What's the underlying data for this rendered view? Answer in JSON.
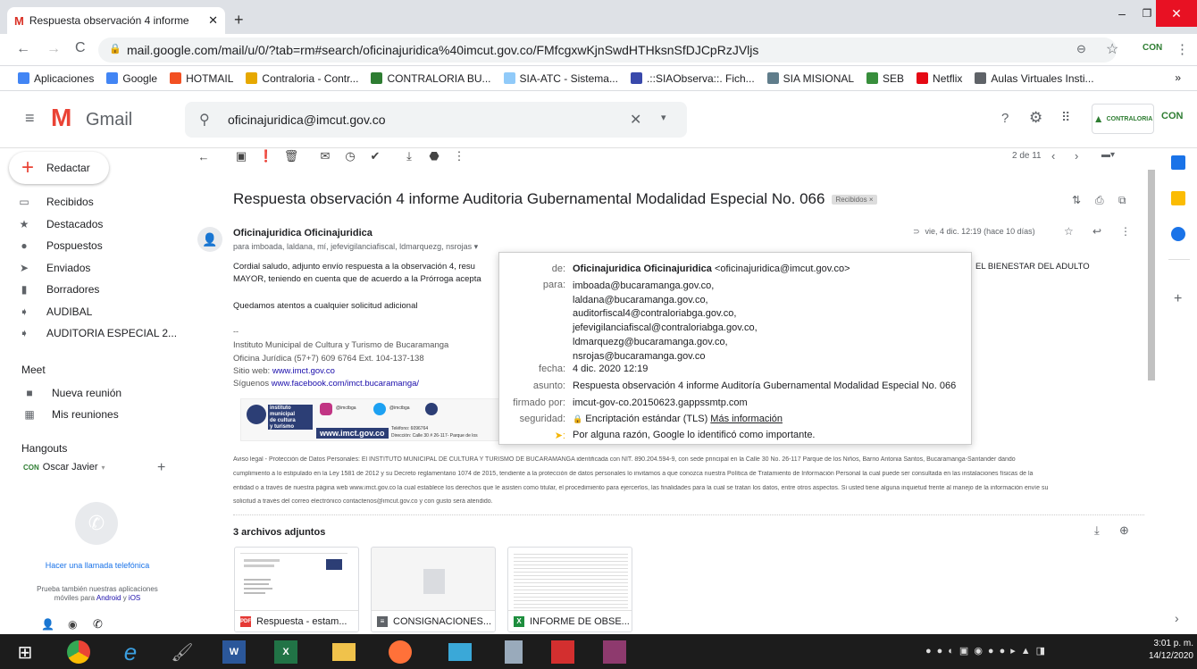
{
  "browser": {
    "tab_title": "Respuesta observación 4 informe",
    "url": "mail.google.com/mail/u/0/?tab=rm#search/oficinajuridica%40imcut.gov.co/FMfcgxwKjnSwdHTHksnSfDJCpRzJVljs",
    "bookmarks": [
      {
        "label": "Aplicaciones",
        "icon": "apps-grid-icon",
        "color": "#4285f4"
      },
      {
        "label": "Google",
        "icon": "google-g-icon",
        "color": "#4285f4"
      },
      {
        "label": "HOTMAIL",
        "icon": "windows-logo-icon",
        "color": "#f25022"
      },
      {
        "label": "Contraloria - Contr...",
        "icon": "contraloria-icon",
        "color": "#e6a800"
      },
      {
        "label": "CONTRALORIA BU...",
        "icon": "contraloria-bu-icon",
        "color": "#2e7d32"
      },
      {
        "label": "SIA-ATC - Sistema...",
        "icon": "sia-atc-icon",
        "color": "#90caf9"
      },
      {
        "label": ".::SIAObserva::. Fich...",
        "icon": "sia-observa-icon",
        "color": "#3949ab"
      },
      {
        "label": "SIA MISIONAL",
        "icon": "sia-misional-icon",
        "color": "#607d8b"
      },
      {
        "label": "SEB",
        "icon": "seb-icon",
        "color": "#388e3c"
      },
      {
        "label": "Netflix",
        "icon": "netflix-icon",
        "color": "#e50914"
      },
      {
        "label": "Aulas Virtuales Insti...",
        "icon": "aulas-icon",
        "color": "#5f6368"
      }
    ]
  },
  "gmail": {
    "brand": "Gmail",
    "search_value": "oficinajuridica@imcut.gov.co",
    "compose": "Redactar",
    "nav": [
      {
        "label": "Recibidos",
        "icon": "inbox-icon"
      },
      {
        "label": "Destacados",
        "icon": "star-icon"
      },
      {
        "label": "Pospuestos",
        "icon": "clock-icon"
      },
      {
        "label": "Enviados",
        "icon": "send-icon"
      },
      {
        "label": "Borradores",
        "icon": "draft-icon"
      },
      {
        "label": "AUDIBAL",
        "icon": "label-icon"
      },
      {
        "label": "AUDITORIA ESPECIAL 2...",
        "icon": "label-icon"
      }
    ],
    "meet": {
      "title": "Meet",
      "items": [
        {
          "label": "Nueva reunión",
          "icon": "video-icon"
        },
        {
          "label": "Mis reuniones",
          "icon": "calendar-icon"
        }
      ]
    },
    "hangouts": {
      "title": "Hangouts",
      "user": "Oscar Javier",
      "phone_link": "Hacer una llamada telefónica",
      "promo": "Prueba también nuestras aplicaciones",
      "promo2_pre": "móviles para",
      "android": "Android",
      "promo2_mid": "y",
      "ios": "iOS"
    },
    "pager": "2 de 11",
    "header_logo": "CONTRALORIA"
  },
  "email": {
    "subject": "Respuesta observación 4 informe Auditoria Gubernamental Modalidad Especial No. 066",
    "label": "Recibidos",
    "sender": "Oficinajuridica Oficinajuridica",
    "recipients": "para imboada, laldana, mí, jefevigilanciafiscal, ldmarquezg, nsrojas",
    "date": "vie, 4 dic. 12:19 (hace 10 días)",
    "body1": "Cordial saludo, adjunto envío respuesta a la observación 4,   resu",
    "body1_right": "EL BIENESTAR DEL ADULTO",
    "body2": "MAYOR, teniendo en cuenta que de acuerdo a la Prórroga acepta",
    "body3": "Quedamos atentos a cualquier solicitud adicional",
    "sig_dashes": "--",
    "sig1": "Instituto Municipal de Cultura y Turismo de Bucaramanga",
    "sig2": "Oficina Jurídica  (57+7) 609 6764 Ext. 104-137-138",
    "sig3_label": "Sitio web:",
    "sig3_link": "www.imct.gov.co",
    "sig4_label": "Síguenos",
    "sig4_link": "www.facebook.com/imct.bucaramanga/",
    "banner_web": "www.imct.gov.co",
    "banner_social": "@imctbga",
    "banner_phone": "Teléfono: 6096764",
    "banner_addr": "Dirección: Calle 30 # 26-117- Parque de los",
    "legal1": "Aviso legal - Protección de Datos Personales: El INSTITUTO MUNICIPAL DE CULTURA Y TURISMO DE BUCARAMANGA identificada con NIT. 890.204.594-9, con sede principal en la Calle 30 No. 26-117 Parque de los Niños, Barrio Antonia Santos, Bucaramanga-Santander dando",
    "legal2": "cumplimiento a lo estipulado en la Ley 1581 de 2012 y su Decreto reglamentario 1074 de 2015, tendiente a la protección de datos personales lo invitamos a que conozca nuestra Política de Tratamiento de Información Personal la cual puede ser consultada en las instalaciones físicas de la",
    "legal3": "entidad o a través de nuestra página web www.imct.gov.co la cual establece los derechos que le asisten como titular, el procedimiento para ejercerlos, las finalidades para la cual se tratan los datos, entre otros aspectos. Si usted tiene alguna inquietud frente al manejo de la información envíe su",
    "legal4": "solicitud a través del correo electrónico contactenos@imcut.gov.co y con gusto será atendido.",
    "attachments_title": "3 archivos adjuntos",
    "attachments": [
      {
        "name": "Respuesta - estam...",
        "type": "PDF",
        "color": "#e53935"
      },
      {
        "name": "CONSIGNACIONES...",
        "type": "DOC",
        "color": "#5f6368"
      },
      {
        "name": "INFORME DE OBSE...",
        "type": "X",
        "color": "#1e8e3e"
      }
    ]
  },
  "details_popup": {
    "de_label": "de:",
    "de_name": "Oficinajuridica Oficinajuridica",
    "de_addr": "<oficinajuridica@imcut.gov.co>",
    "para_label": "para:",
    "para": [
      "imboada@bucaramanga.gov.co,",
      "laldana@bucaramanga.gov.co,",
      "auditorfiscal4@contraloriabga.gov.co,",
      "jefevigilanciafiscal@contraloriabga.gov.co,",
      "ldmarquezg@bucaramanga.gov.co,",
      "nsrojas@bucaramanga.gov.co"
    ],
    "fecha_label": "fecha:",
    "fecha": "4 dic. 2020 12:19",
    "asunto_label": "asunto:",
    "asunto": "Respuesta observación 4 informe Auditoría Gubernamental Modalidad Especial No. 066",
    "firmado_label": "firmado por:",
    "firmado": "imcut-gov-co.20150623.gappssmtp.com",
    "seguridad_label": "seguridad:",
    "seguridad": "Encriptación estándar (TLS)",
    "seguridad_link": "Más información",
    "important": "Por alguna razón, Google lo identificó como importante."
  },
  "taskbar": {
    "time": "3:01 p. m.",
    "date": "14/12/2020"
  }
}
